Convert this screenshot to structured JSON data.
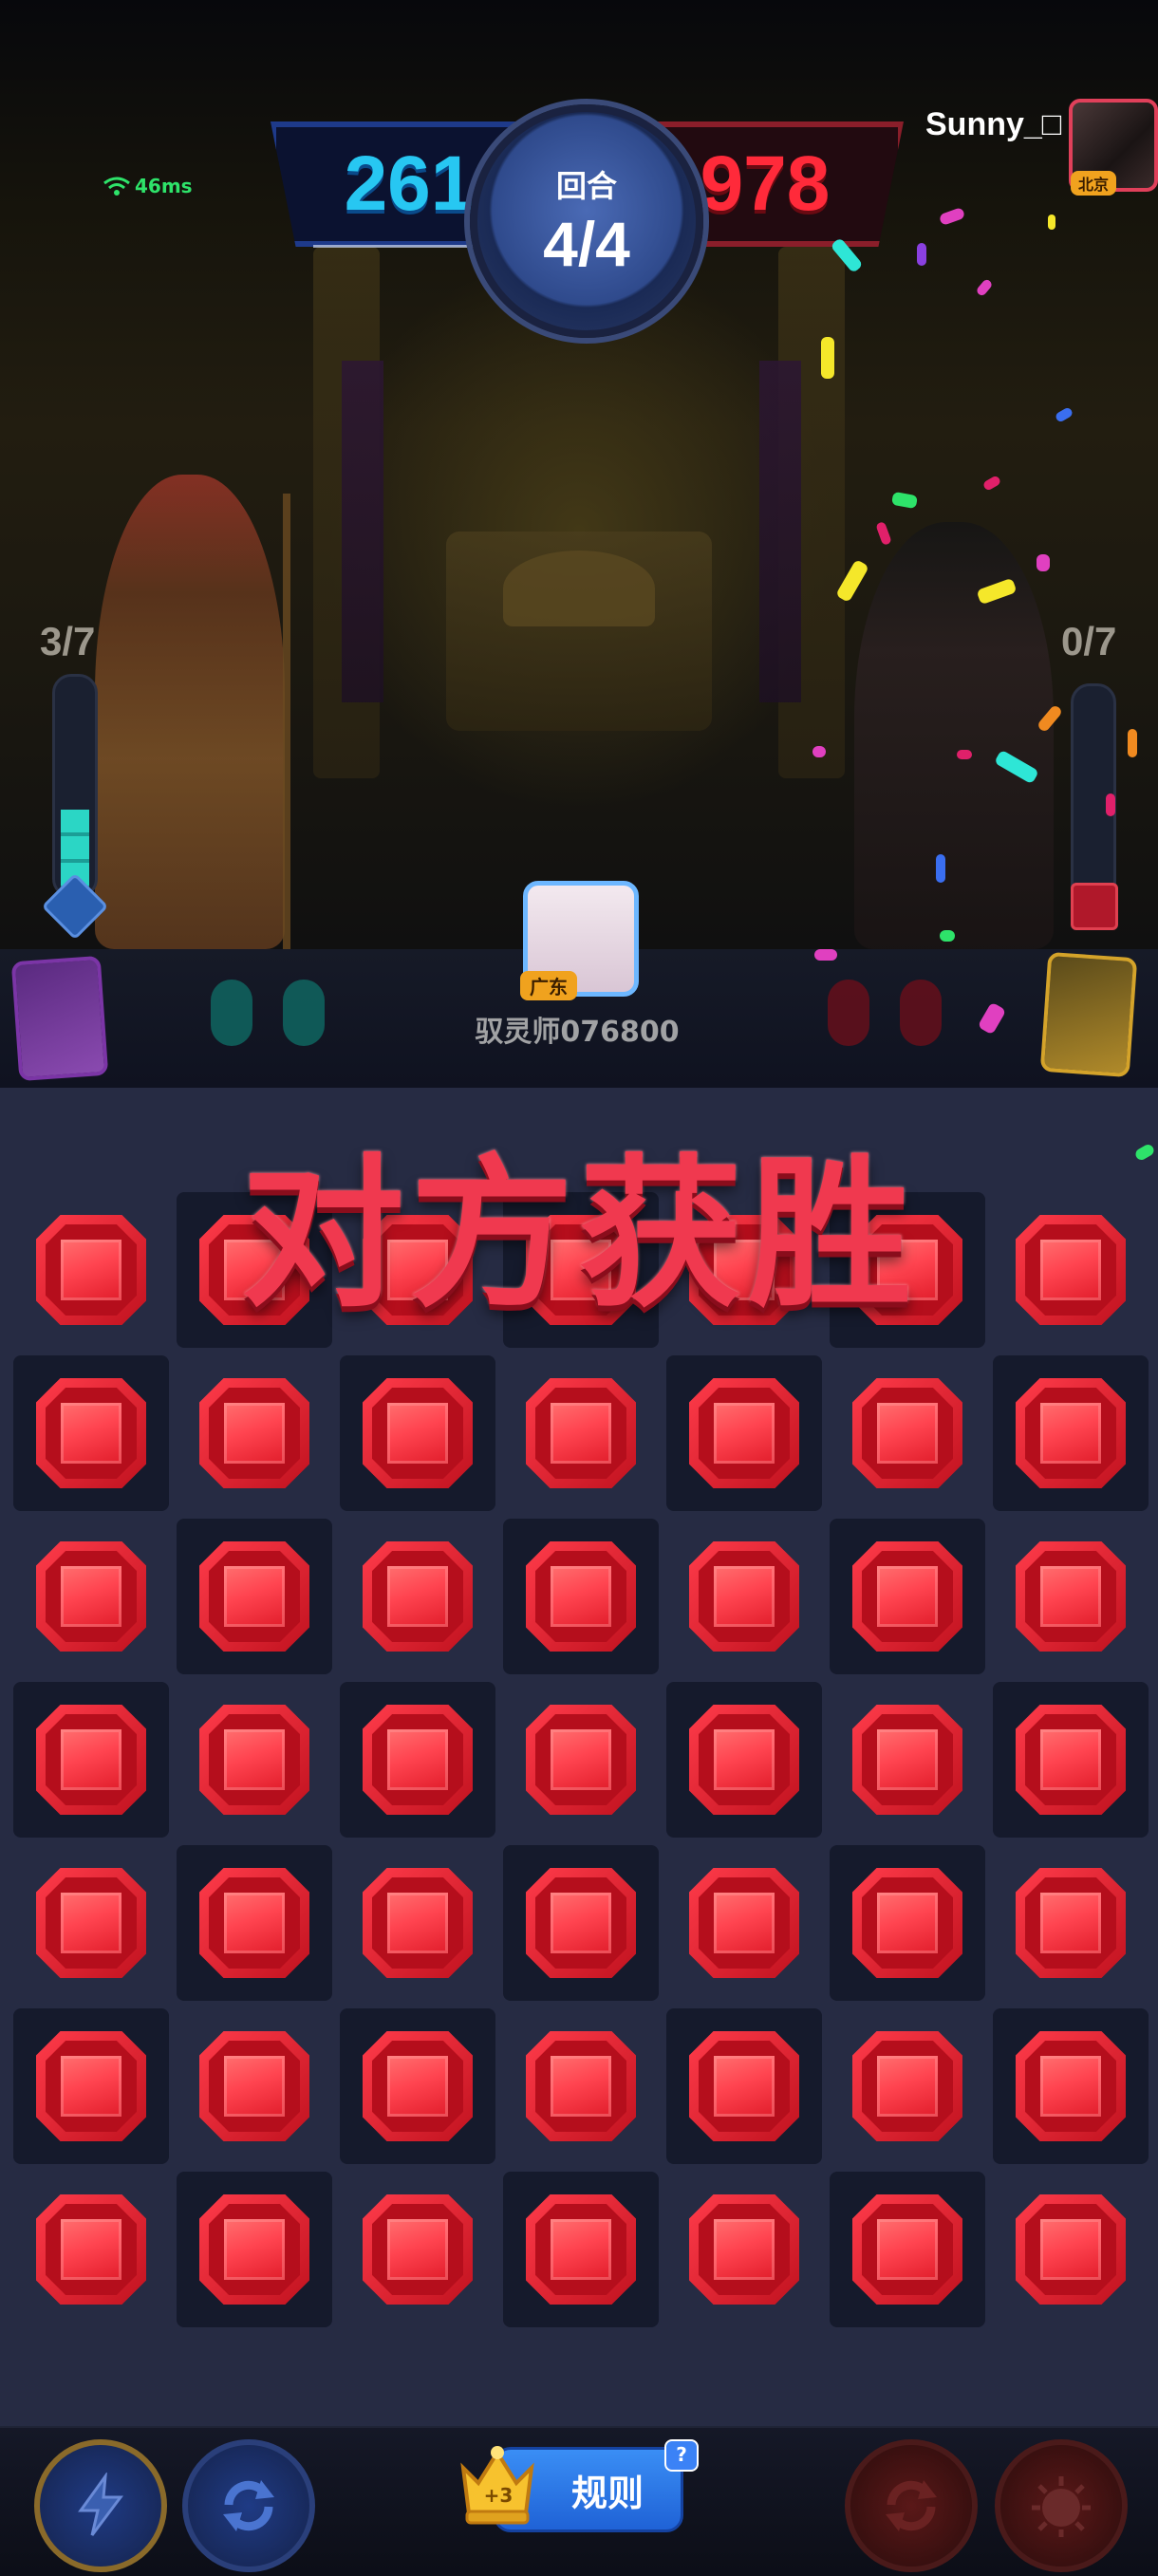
{
  "scoreboard": {
    "player_score": "261",
    "opponent_score": "978",
    "round_label": "回合",
    "round_value": "4/4"
  },
  "network": {
    "latency": "46ms"
  },
  "opponent": {
    "name": "Sunny_□",
    "region": "北京",
    "energy": "0/7"
  },
  "player": {
    "energy": "3/7",
    "energy_fraction": 0.43
  },
  "center_player": {
    "region": "广东",
    "name": "驭灵师076800"
  },
  "result": {
    "banner": "对方获胜"
  },
  "board": {
    "rows": 7,
    "cols": 7,
    "gem": "red-gem"
  },
  "bottom_bar": {
    "rules_label": "规则",
    "crown_count": "+3",
    "help": "?",
    "skills": [
      "lightning-icon",
      "refresh-icon",
      "opponent-refresh-icon",
      "opponent-bomb-icon"
    ]
  },
  "colors": {
    "player_accent": "#27c7f2",
    "opponent_accent": "#ff2a3a",
    "gem": "#e11d2b",
    "board_bg": "#262b43"
  }
}
